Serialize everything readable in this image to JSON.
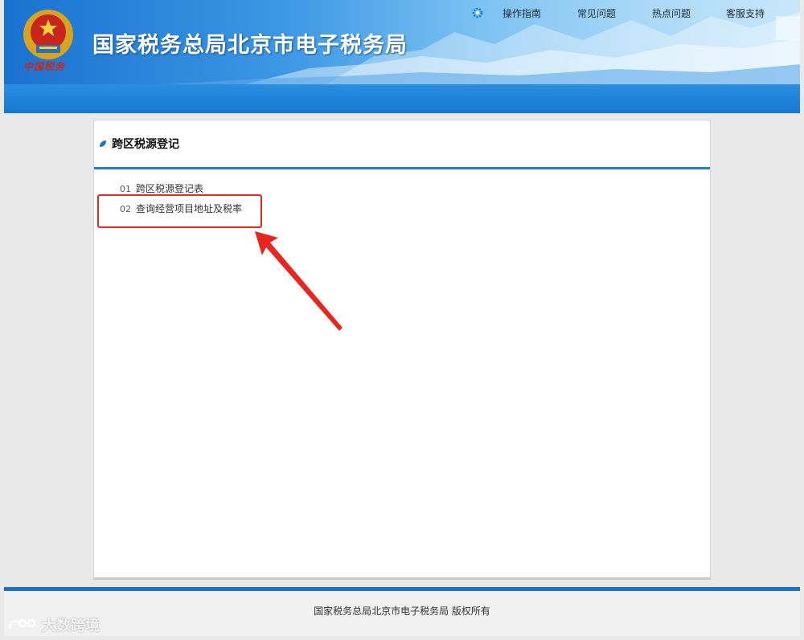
{
  "header": {
    "site_title": "国家税务总局北京市电子税务局",
    "emblem_text": "中国税务",
    "nav": {
      "guide": "操作指南",
      "faq": "常见问题",
      "hot": "热点问题",
      "support": "客服支持"
    }
  },
  "panel": {
    "title": "跨区税源登记",
    "items": [
      {
        "num": "01",
        "label": "跨区税源登记表"
      },
      {
        "num": "02",
        "label": "查询经营项目地址及税率"
      }
    ]
  },
  "footer": {
    "copyright": "国家税务总局北京市电子税务局 版权所有"
  },
  "watermark": {
    "text": "大数跨境"
  },
  "colors": {
    "accent_blue": "#1f7fd0",
    "highlight_red": "#e8261f"
  }
}
